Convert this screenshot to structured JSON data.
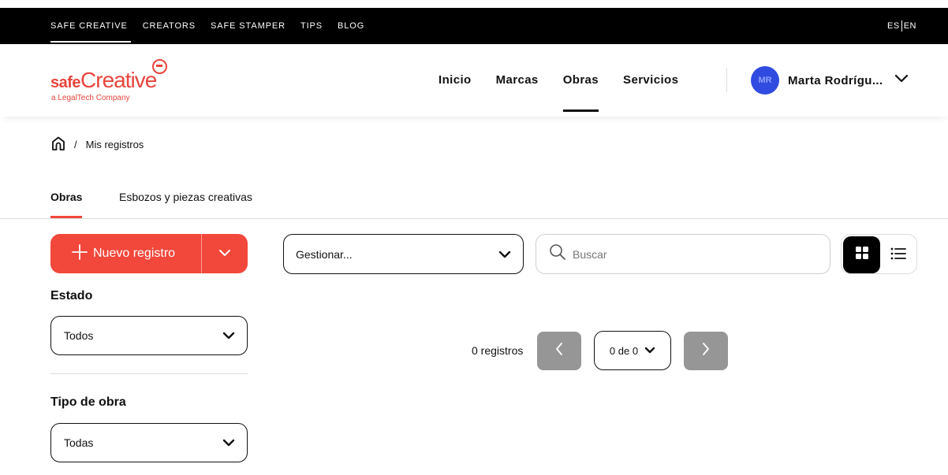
{
  "topbar": {
    "links": [
      "SAFE CREATIVE",
      "CREATORS",
      "SAFE STAMPER",
      "TIPS",
      "BLOG"
    ],
    "active": "SAFE CREATIVE",
    "lang_es": "ES",
    "lang_en": "EN"
  },
  "brand": {
    "logo_bold": "safe",
    "logo_light": "Creative",
    "tagline": "a LegalTech Company",
    "color": "#e8453c"
  },
  "nav": {
    "items": [
      "Inicio",
      "Marcas",
      "Obras",
      "Servicios"
    ],
    "active": "Obras"
  },
  "user": {
    "initials": "MR",
    "name": "Marta Rodrígu..."
  },
  "breadcrumb": {
    "current": "Mis registros",
    "separator": "/"
  },
  "tabs": {
    "items": [
      "Obras",
      "Esbozos y piezas creativas"
    ],
    "active": "Obras"
  },
  "actions": {
    "new_label": "Nuevo registro",
    "accent": "#f2473b"
  },
  "filters": {
    "estado_label": "Estado",
    "estado_value": "Todos",
    "tipo_label": "Tipo de obra",
    "tipo_value": "Todas"
  },
  "toolbar": {
    "manage_value": "Gestionar...",
    "search_placeholder": "Buscar",
    "view_mode": "grid"
  },
  "pagination": {
    "count_label": "0 registros",
    "page_label": "0 de 0"
  }
}
